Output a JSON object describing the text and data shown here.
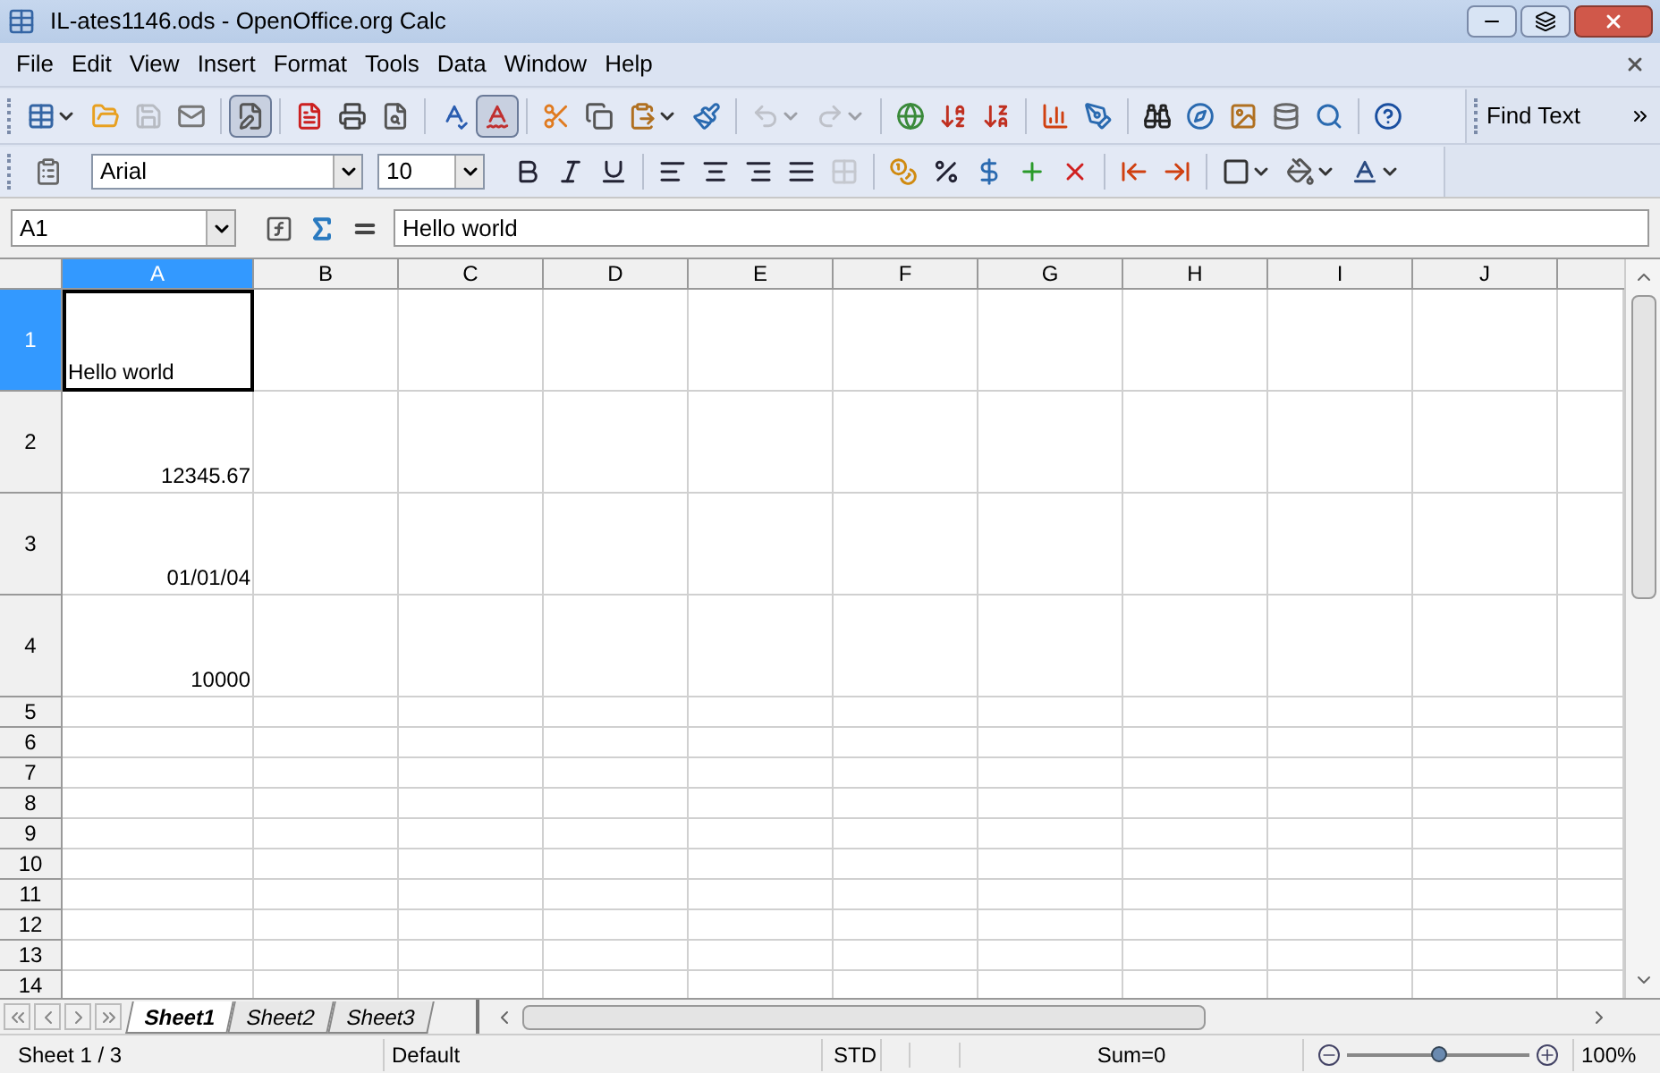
{
  "window": {
    "title": "IL-ates1146.ods - OpenOffice.org Calc"
  },
  "menu": [
    "File",
    "Edit",
    "View",
    "Insert",
    "Format",
    "Tools",
    "Data",
    "Window",
    "Help"
  ],
  "toolbar_standard": [
    {
      "kind": "button",
      "pressed": false,
      "disabled": false,
      "dropdown": true
    },
    {
      "kind": "button",
      "pressed": false,
      "disabled": false,
      "dropdown": false
    },
    {
      "kind": "button",
      "pressed": false,
      "disabled": true,
      "dropdown": false
    },
    {
      "kind": "button",
      "pressed": false,
      "disabled": false,
      "dropdown": false
    },
    {
      "kind": "separator"
    },
    {
      "kind": "button",
      "pressed": true,
      "disabled": false,
      "dropdown": false
    },
    {
      "kind": "separator"
    },
    {
      "kind": "button",
      "pressed": false,
      "disabled": false,
      "dropdown": false
    },
    {
      "kind": "button",
      "pressed": false,
      "disabled": false,
      "dropdown": false
    },
    {
      "kind": "button",
      "pressed": false,
      "disabled": false,
      "dropdown": false
    },
    {
      "kind": "separator"
    },
    {
      "kind": "button",
      "pressed": false,
      "disabled": false,
      "dropdown": false
    },
    {
      "kind": "button",
      "pressed": true,
      "disabled": false,
      "dropdown": false
    },
    {
      "kind": "separator"
    },
    {
      "kind": "button",
      "pressed": false,
      "disabled": false,
      "dropdown": false
    },
    {
      "kind": "button",
      "pressed": false,
      "disabled": false,
      "dropdown": false
    },
    {
      "kind": "button",
      "pressed": false,
      "disabled": false,
      "dropdown": true
    },
    {
      "kind": "button",
      "pressed": false,
      "disabled": false,
      "dropdown": false
    },
    {
      "kind": "separator"
    },
    {
      "kind": "button",
      "pressed": false,
      "disabled": true,
      "dropdown": true
    },
    {
      "kind": "button",
      "pressed": false,
      "disabled": true,
      "dropdown": true
    },
    {
      "kind": "separator"
    },
    {
      "kind": "button",
      "pressed": false,
      "disabled": false,
      "dropdown": false
    },
    {
      "kind": "button",
      "pressed": false,
      "disabled": false,
      "dropdown": false
    },
    {
      "kind": "button",
      "pressed": false,
      "disabled": false,
      "dropdown": false
    },
    {
      "kind": "separator"
    },
    {
      "kind": "button",
      "pressed": false,
      "disabled": false,
      "dropdown": false
    },
    {
      "kind": "button",
      "pressed": false,
      "disabled": false,
      "dropdown": false
    },
    {
      "kind": "separator"
    },
    {
      "kind": "button",
      "pressed": false,
      "disabled": false,
      "dropdown": false
    },
    {
      "kind": "button",
      "pressed": false,
      "disabled": false,
      "dropdown": false
    },
    {
      "kind": "button",
      "pressed": false,
      "disabled": false,
      "dropdown": false
    },
    {
      "kind": "button",
      "pressed": false,
      "disabled": false,
      "dropdown": false
    },
    {
      "kind": "button",
      "pressed": false,
      "disabled": false,
      "dropdown": false
    },
    {
      "kind": "separator"
    },
    {
      "kind": "button",
      "pressed": false,
      "disabled": false,
      "dropdown": false
    }
  ],
  "find_toolbar": {
    "placeholder": "Find Text"
  },
  "toolbar_formatting": {
    "font": "Arial",
    "size": "10",
    "buttons": [
      {
        "kind": "button",
        "disabled": false,
        "dropdown": false
      },
      {
        "kind": "button",
        "disabled": false,
        "dropdown": false
      },
      {
        "kind": "button",
        "disabled": false,
        "dropdown": false
      },
      {
        "kind": "separator"
      },
      {
        "kind": "button",
        "disabled": false,
        "dropdown": false
      },
      {
        "kind": "button",
        "disabled": false,
        "dropdown": false
      },
      {
        "kind": "button",
        "disabled": false,
        "dropdown": false
      },
      {
        "kind": "button",
        "disabled": false,
        "dropdown": false
      },
      {
        "kind": "button",
        "disabled": true,
        "dropdown": false
      },
      {
        "kind": "separator"
      },
      {
        "kind": "button",
        "disabled": false,
        "dropdown": false
      },
      {
        "kind": "button",
        "disabled": false,
        "dropdown": false
      },
      {
        "kind": "button",
        "disabled": false,
        "dropdown": false
      },
      {
        "kind": "button",
        "disabled": false,
        "dropdown": false
      },
      {
        "kind": "button",
        "disabled": false,
        "dropdown": false
      },
      {
        "kind": "separator"
      },
      {
        "kind": "button",
        "disabled": false,
        "dropdown": false
      },
      {
        "kind": "button",
        "disabled": false,
        "dropdown": false
      },
      {
        "kind": "separator"
      },
      {
        "kind": "button",
        "disabled": false,
        "dropdown": true
      },
      {
        "kind": "button",
        "disabled": false,
        "dropdown": true
      },
      {
        "kind": "button",
        "disabled": false,
        "dropdown": true
      }
    ]
  },
  "formula_bar": {
    "name_box": "A1",
    "value": "Hello world"
  },
  "sheet": {
    "columns": [
      {
        "label": "A",
        "selected": true
      },
      {
        "label": "B",
        "selected": false
      },
      {
        "label": "C",
        "selected": false
      },
      {
        "label": "D",
        "selected": false
      },
      {
        "label": "E",
        "selected": false
      },
      {
        "label": "F",
        "selected": false
      },
      {
        "label": "G",
        "selected": false
      },
      {
        "label": "H",
        "selected": false
      },
      {
        "label": "I",
        "selected": false
      },
      {
        "label": "J",
        "selected": false
      }
    ],
    "rows": [
      {
        "label": "1",
        "selected": true,
        "cells": [
          {
            "text": "Hello world",
            "kind": "text",
            "active": true
          }
        ]
      },
      {
        "label": "2",
        "selected": false,
        "cells": [
          {
            "text": "12345.67",
            "kind": "number",
            "active": false
          }
        ]
      },
      {
        "label": "3",
        "selected": false,
        "cells": [
          {
            "text": "01/01/04",
            "kind": "number",
            "active": false
          }
        ]
      },
      {
        "label": "4",
        "selected": false,
        "cells": [
          {
            "text": "10000",
            "kind": "number",
            "active": false
          }
        ]
      },
      {
        "label": "5",
        "selected": false
      },
      {
        "label": "6",
        "selected": false
      },
      {
        "label": "7",
        "selected": false
      },
      {
        "label": "8",
        "selected": false
      },
      {
        "label": "9",
        "selected": false
      },
      {
        "label": "10",
        "selected": false
      },
      {
        "label": "11",
        "selected": false
      },
      {
        "label": "12",
        "selected": false
      },
      {
        "label": "13",
        "selected": false
      },
      {
        "label": "14",
        "selected": false
      }
    ]
  },
  "sheet_tabs": [
    {
      "label": "Sheet1",
      "selected": true
    },
    {
      "label": "Sheet2",
      "selected": false
    },
    {
      "label": "Sheet3",
      "selected": false
    }
  ],
  "status_bar": {
    "sheet": "Sheet 1 / 3",
    "page_style": "Default",
    "mode": "STD",
    "sum": "Sum=0",
    "zoom": {
      "level": 0.5
    },
    "zoom_percent": "100%"
  }
}
